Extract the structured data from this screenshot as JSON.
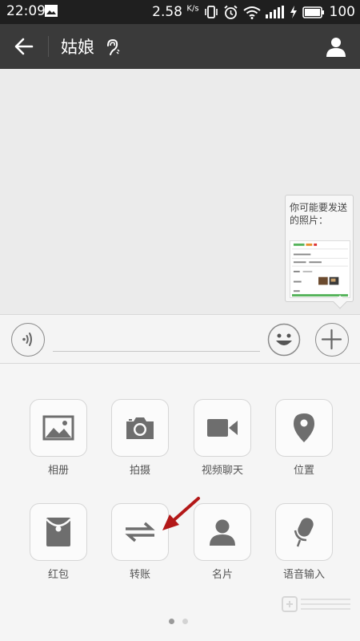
{
  "status_bar": {
    "time": "22:09",
    "network_speed": "2.58",
    "speed_unit": "K/s",
    "battery": "100"
  },
  "header": {
    "title": "姑娘"
  },
  "chat": {
    "photo_suggestion": "你可能要发送的照片："
  },
  "input_bar": {
    "text_value": "",
    "placeholder": ""
  },
  "panel": {
    "tiles": [
      {
        "label": "相册",
        "icon": "album-icon"
      },
      {
        "label": "拍摄",
        "icon": "camera-icon"
      },
      {
        "label": "视频聊天",
        "icon": "video-call-icon"
      },
      {
        "label": "位置",
        "icon": "location-icon"
      },
      {
        "label": "红包",
        "icon": "red-packet-icon"
      },
      {
        "label": "转账",
        "icon": "transfer-icon"
      },
      {
        "label": "名片",
        "icon": "contact-card-icon"
      },
      {
        "label": "语音输入",
        "icon": "voice-input-icon"
      }
    ],
    "page_count": 2,
    "current_page": 1
  },
  "annotation": {
    "arrow_color": "#b31818"
  },
  "colors": {
    "header_bg": "#3a3a3a",
    "statusbar_bg": "#1f1f1f",
    "icon_gray": "#6e6e6e"
  }
}
